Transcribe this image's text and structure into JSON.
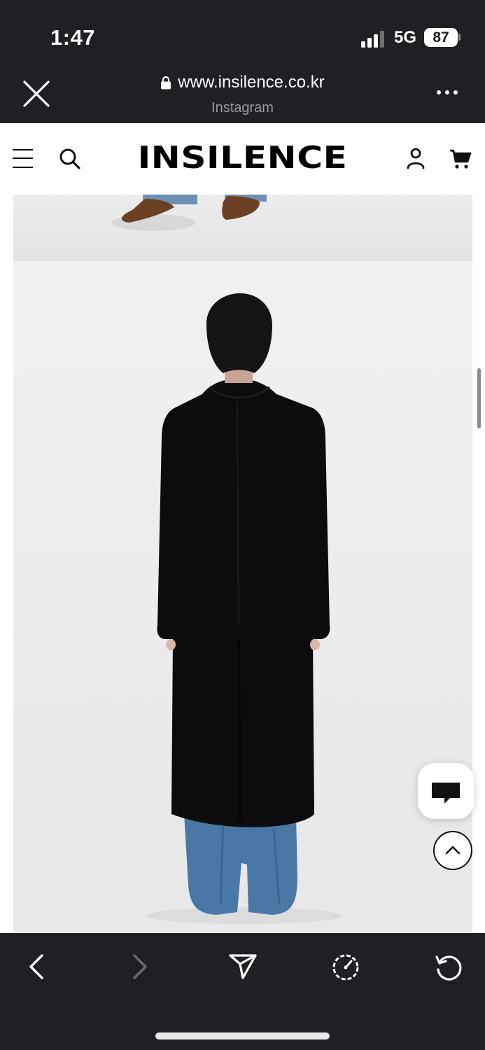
{
  "status_bar": {
    "time": "1:47",
    "network": "5G",
    "battery": "87"
  },
  "browser": {
    "url": "www.insilence.co.kr",
    "source": "Instagram",
    "close_icon": "close-icon",
    "more_icon": "more-icon"
  },
  "site": {
    "logo": "INSILENCE",
    "icons": [
      "menu-icon",
      "search-icon",
      "user-icon",
      "cart-icon"
    ]
  },
  "content": {
    "images": [
      "product-photo-boots-crop",
      "product-photo-coat-back-view"
    ],
    "floating": [
      "chat-icon",
      "scroll-top-icon"
    ]
  },
  "toolbar": {
    "icons": [
      "back-icon",
      "forward-icon",
      "share-icon",
      "speedometer-icon",
      "reload-icon"
    ]
  },
  "colors": {
    "chrome_dark": "#1f2024",
    "coat": "#0c0c0e",
    "jeans": "#4a78a6",
    "boots": "#6b4025"
  }
}
